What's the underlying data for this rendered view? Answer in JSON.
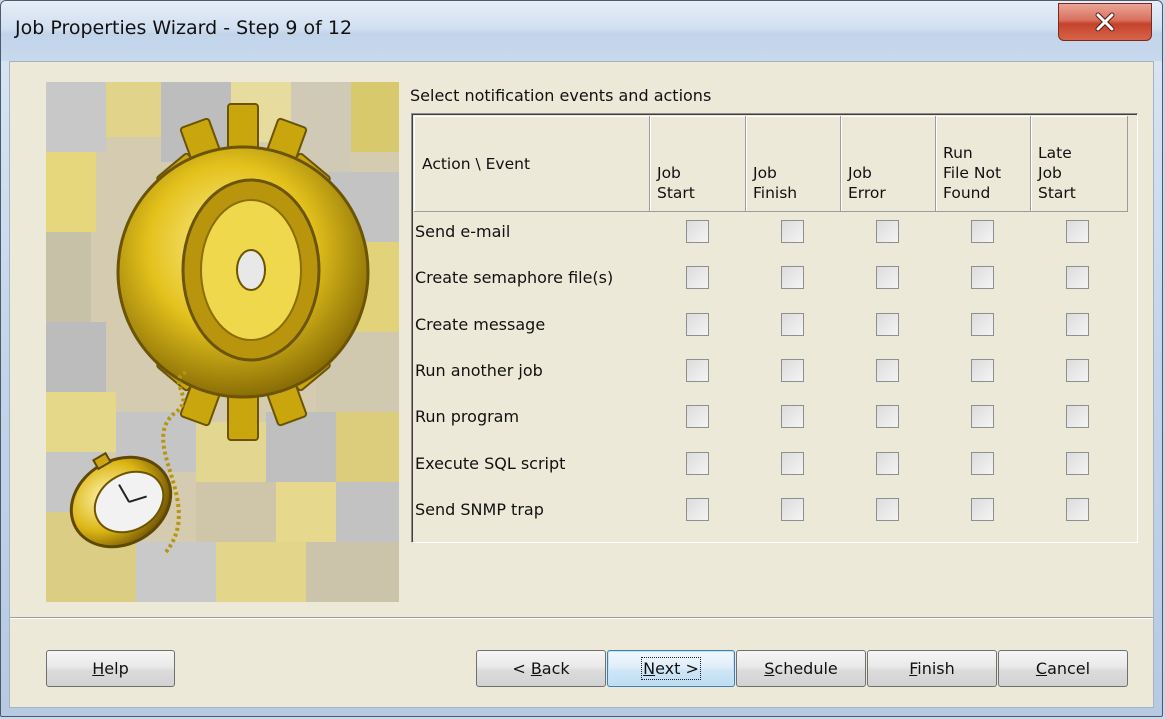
{
  "window": {
    "title": "Job Properties Wizard - Step 9 of 12"
  },
  "content": {
    "instruction": "Select notification events and actions"
  },
  "grid": {
    "header_action": "Action \\ Event",
    "events": [
      {
        "lines": [
          "Job",
          "Start"
        ]
      },
      {
        "lines": [
          "Job",
          "Finish"
        ]
      },
      {
        "lines": [
          "Job",
          "Error"
        ]
      },
      {
        "lines": [
          "Run",
          "File Not",
          "Found"
        ]
      },
      {
        "lines": [
          "Late",
          "Job",
          "Start"
        ]
      }
    ],
    "actions": [
      {
        "label": "Send e-mail",
        "checked": [
          false,
          false,
          false,
          false,
          false
        ]
      },
      {
        "label": "Create semaphore file(s)",
        "checked": [
          false,
          false,
          false,
          false,
          false
        ]
      },
      {
        "label": "Create message",
        "checked": [
          false,
          false,
          false,
          false,
          false
        ]
      },
      {
        "label": "Run another job",
        "checked": [
          false,
          false,
          false,
          false,
          false
        ]
      },
      {
        "label": "Run program",
        "checked": [
          false,
          false,
          false,
          false,
          false
        ]
      },
      {
        "label": "Execute SQL script",
        "checked": [
          false,
          false,
          false,
          false,
          false
        ]
      },
      {
        "label": "Send SNMP trap",
        "checked": [
          false,
          false,
          false,
          false,
          false
        ]
      }
    ]
  },
  "buttons": {
    "help": {
      "pre": "",
      "key": "H",
      "post": "elp"
    },
    "back": {
      "pre": "< ",
      "key": "B",
      "post": "ack"
    },
    "next": {
      "pre": "",
      "key": "N",
      "post": "ext >"
    },
    "schedule": {
      "pre": "",
      "key": "S",
      "post": "chedule"
    },
    "finish": {
      "pre": "",
      "key": "F",
      "post": "inish"
    },
    "cancel": {
      "pre": "",
      "key": "C",
      "post": "ancel"
    }
  },
  "icons": {
    "close": "close-icon",
    "illustration": "gear-and-pocket-watch-illustration"
  },
  "colors": {
    "dialog_face": "#ece9d8",
    "close_button": "#c5432b",
    "default_button_border": "#3c7fb1"
  }
}
